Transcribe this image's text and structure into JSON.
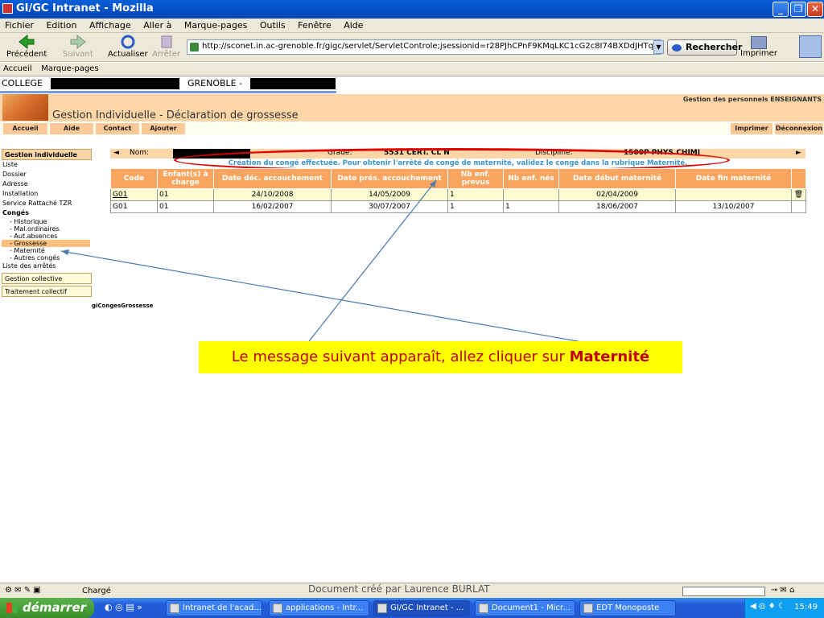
{
  "window": {
    "title": "GI/GC Intranet - Mozilla"
  },
  "menu": [
    "Fichier",
    "Edition",
    "Affichage",
    "Aller à",
    "Marque-pages",
    "Outils",
    "Fenêtre",
    "Aide"
  ],
  "nav": {
    "back": "Précédent",
    "forward": "Suivant",
    "reload": "Actualiser",
    "stop": "Arrêter",
    "url": "http://sconet.in.ac-grenoble.fr/gigc/servlet/ServletControle;jsessionid=r28PJhCPnF9KMqLKC1cG2c8I74BXDdJHTqnhHKTbys",
    "search": "Rechercher",
    "print": "Imprimer"
  },
  "bookmarks": [
    "Accueil",
    "Marque-pages"
  ],
  "top": {
    "college": "COLLEGE",
    "city": "GRENOBLE -"
  },
  "header": {
    "title": "Gestion Individuelle - Déclaration de grossesse",
    "right": "Gestion des personnels ENSEIGNANTS"
  },
  "tabs": [
    "Accueil",
    "Aide",
    "Contact",
    "Ajouter",
    "Imprimer",
    "Déconnexion"
  ],
  "sidebar": {
    "section1": "Gestion individuelle",
    "items": [
      "Liste",
      "Dossier",
      "Adresse",
      "Installation",
      "Service Rattaché TZR",
      "Congés"
    ],
    "subitems": [
      "- Historique",
      "- Mal.ordinaires",
      "- Aut.absences",
      "- Grossesse",
      "- Maternité",
      "- Autres congés"
    ],
    "after": "Liste des arrêtés",
    "section2": "Gestion collective",
    "section3": "Traitement collectif",
    "code": "giCongesGrossesse"
  },
  "info": {
    "nom_label": "Nom:",
    "grade_label": "Grade:",
    "grade_value": "5531 CERT. CL N",
    "discipline_label": "Discipline:",
    "discipline_value": "1500P PHYS.CHIMI"
  },
  "message": "Création du congé effectuée. Pour obtenir l'arrêté de congé de maternité, validez le congé dans la rubrique Maternité.",
  "table": {
    "headers": [
      "Code",
      "Enfant(s) à charge",
      "Date déc. accouchement",
      "Date prés. accouchement",
      "Nb enf. prevus",
      "Nb enf. nés",
      "Date début maternité",
      "Date fin maternité"
    ],
    "rows": [
      [
        "G01",
        "01",
        "24/10/2008",
        "14/05/2009",
        "1",
        "",
        "02/04/2009",
        ""
      ],
      [
        "G01",
        "01",
        "16/02/2007",
        "30/07/2007",
        "1",
        "1",
        "18/06/2007",
        "13/10/2007"
      ]
    ]
  },
  "callout": {
    "text": "Le message suivant apparaît, allez cliquer sur ",
    "bold": "Maternité"
  },
  "status": {
    "text": "Chargé",
    "docby": "Document créé par Laurence BURLAT"
  },
  "taskbar": {
    "start": "démarrer",
    "tasks": [
      "Intranet de l'acad...",
      "applications - Intr...",
      "GI/GC Intranet - ...",
      "Document1 - Micr...",
      "EDT Monoposte"
    ],
    "clock": "15:49"
  }
}
